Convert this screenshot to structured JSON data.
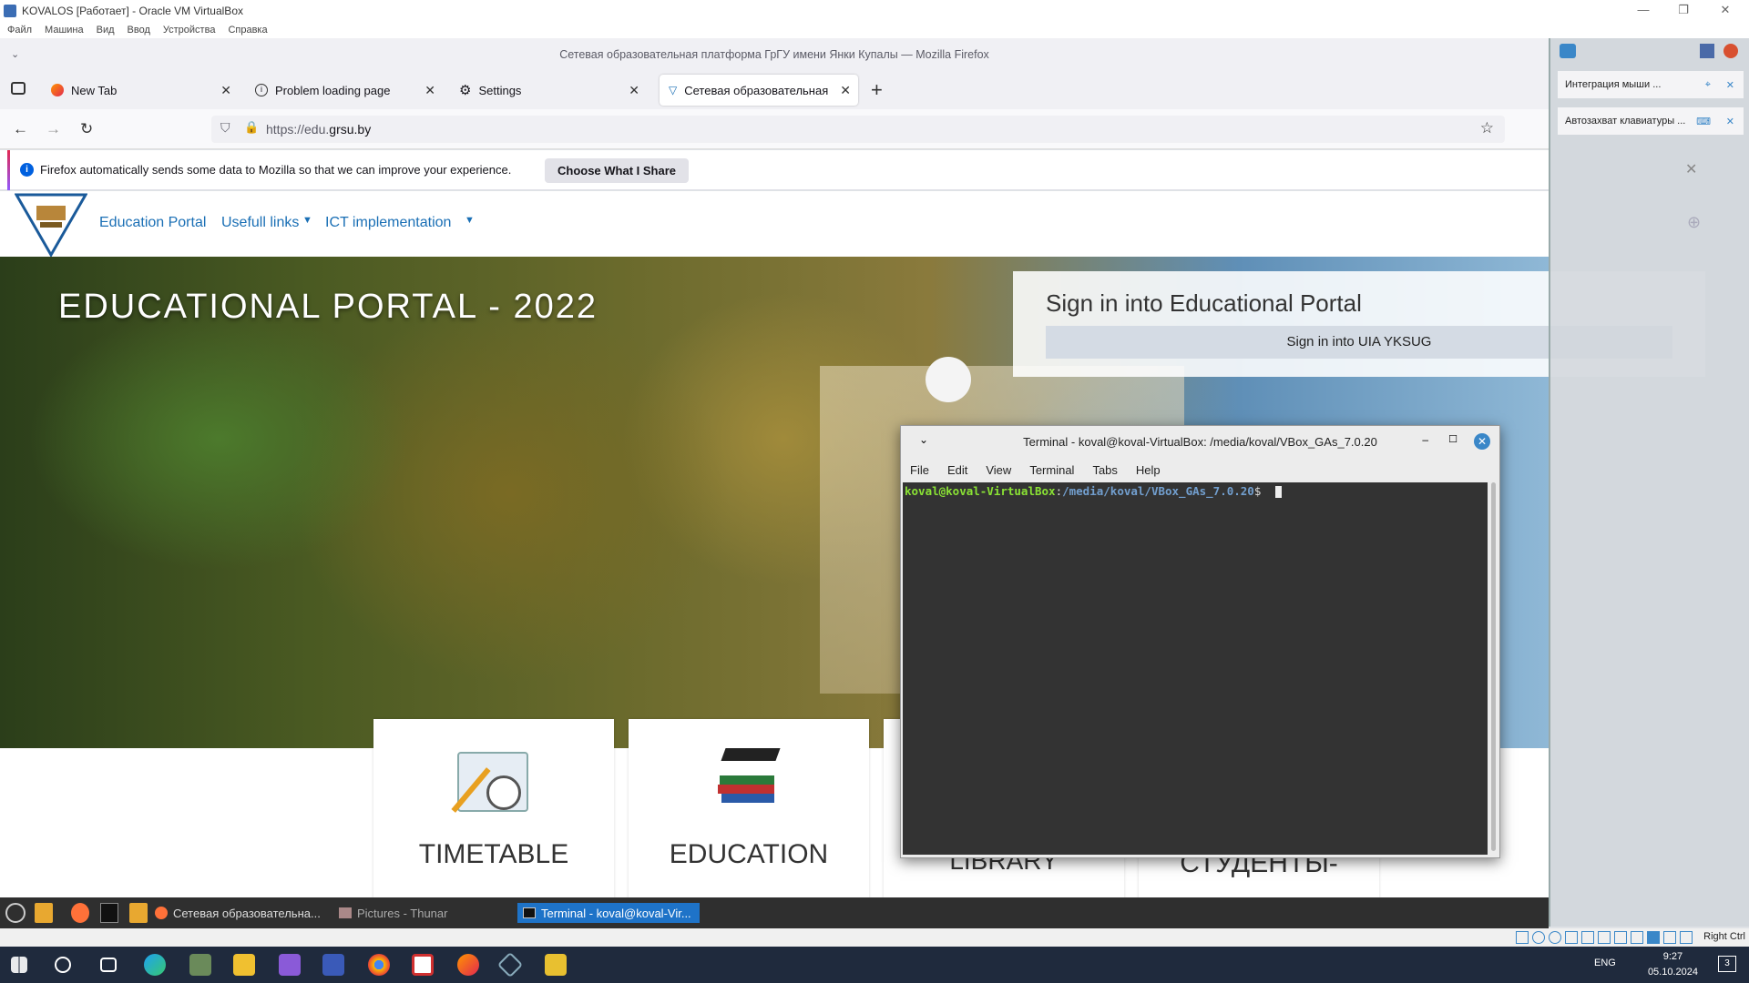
{
  "vbox": {
    "title": "KOVALOS [Работает] - Oracle VM VirtualBox",
    "menu": [
      "Файл",
      "Машина",
      "Вид",
      "Ввод",
      "Устройства",
      "Справка"
    ],
    "side_items": [
      "Интеграция мыши ...",
      "Автозахват клавиатуры ..."
    ],
    "status_right": "Right Ctrl"
  },
  "firefox": {
    "window_title": "Сетевая образовательная платформа ГрГУ имени Янки Купалы — Mozilla Firefox",
    "tabs": [
      {
        "label": "New Tab"
      },
      {
        "label": "Problem loading page"
      },
      {
        "label": "Settings"
      },
      {
        "label": "Сетевая образовательная"
      }
    ],
    "url_prefix": "https://edu.",
    "url_domain": "grsu.by",
    "notice_text": "Firefox automatically sends some data to Mozilla so that we can improve your experience.",
    "notice_button": "Choose What I Share"
  },
  "site": {
    "nav": [
      "Education Portal",
      "Usefull links",
      "ICT implementation"
    ],
    "hero_title": "EDUCATIONAL PORTAL - 2022",
    "signin_title": "Sign in into Educational Portal",
    "signin_button": "Sign in into UIA YKSUG",
    "cards": [
      "TIMETABLE",
      "EDUCATION",
      "LIBRARY",
      "СТУДЕНТЫ-"
    ]
  },
  "terminal": {
    "title": "Terminal - koval@koval-VirtualBox: /media/koval/VBox_GAs_7.0.20",
    "menu": [
      "File",
      "Edit",
      "View",
      "Terminal",
      "Tabs",
      "Help"
    ],
    "prompt_user": "koval@koval-VirtualBox",
    "prompt_sep": ":",
    "prompt_path": "/media/koval/VBox_GAs_7.0.20",
    "prompt_end": "$"
  },
  "guest_taskbar": {
    "items": [
      "Сетевая образовательна...",
      "Pictures - Thunar",
      "Terminal - koval@koval-Vir..."
    ]
  },
  "host": {
    "lang": "ENG",
    "time": "9:27",
    "date": "05.10.2024",
    "notif_count": "3"
  }
}
